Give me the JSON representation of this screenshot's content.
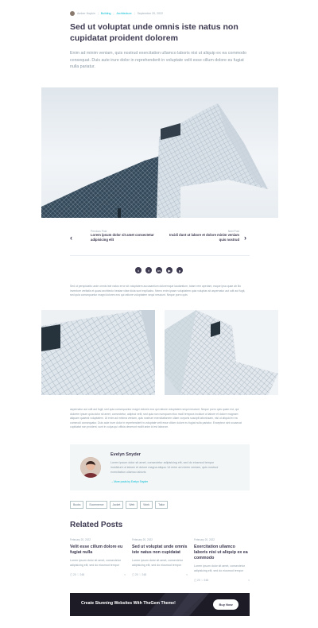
{
  "meta": {
    "author": "Amber Hopkin",
    "cat1": "Building",
    "cat2": "Architecture",
    "date": "September 20, 2022"
  },
  "post": {
    "title": "Sed ut voluptat unde omnis iste natus non cupidatat proident dolorem",
    "lead": "Enim ad minim veniam, quis nostrud exercitation ullamco laboris nisi ut aliquip ex ea commodo consequat. Duis aute irure dolor in reprehenderit in voluptate velit esse cillum dolore eu fugiat nulla pariatur."
  },
  "nav": {
    "prev_label": "Previous Post",
    "prev_title": "Lorem ipsum dolor sit amet consectetur adipisicing elit",
    "next_label": "Next Post",
    "next_title": "Incidi dunt ut labore et dolore minim veniam quis nostrud"
  },
  "social": [
    "twitter-icon",
    "facebook-icon",
    "linkedin-icon",
    "youtube-icon",
    "pinterest-icon"
  ],
  "body": {
    "p1": "Sed ut perspiciatis unde omnis iste natus error sit voluptatem accusantium doloremque laudantium, totam rem aperiam, eaque ipsa quae ab illo inventore veritatis et quasi architecto beatae vitae dicta sunt explicabo. Nemo enim ipsam voluptatem quia voluptas sit aspernatur aut odit aut fugit, sed quia consequuntur magni dolores eos qui ratione voluptatem sequi nesciunt. Neque porro quis",
    "p2": "aspernatur aut odit aut fugit, sed quia consequuntur magni dolores eos qui ratione voluptatem sequi nesciunt. Neque porro quis quam est, qui dolorem ipsum quia dolor sit amet, consectetur, adipisci velit, sed quia non numquam eius modi tempora incidunt ut labore et dolore magnam aliquam quaerat voluptatem. Ut enim ad minima veniam, quis nostrum exercitationem ullam corporis suscipit laboriosam, nisi ut aliquid ex ea commodi consequatur. Duis aute irure dolor in reprehenderit in voluptate velit esse cillum dolore eu fugiat nulla pariatur. Excepteur sint occaecat cupidatat non proident, sunt in culpa qui officia deserunt mollit anim id est laborum."
  },
  "author_box": {
    "name": "Evelyn Snyder",
    "desc": "Lorem ipsum dolor sit amet, consectetur adipisicing elit, sed do eiusmod tempor incididunt ut labore et dolore magna aliqua. Ut enim ad minim veniam, quis nostrud exercitation ullamco laboris",
    "link": "→ More posts by Evelyn Snyder"
  },
  "tags": [
    "Books",
    "Ecommerce",
    "Jacket",
    "Web",
    "Work",
    "Tailor"
  ],
  "related": {
    "heading": "Related Posts",
    "posts": [
      {
        "date": "February 20, 2022",
        "title": "Velit esse cillum dolore eu fugiat nulla",
        "excerpt": "Lorem ipsum dolor sit amet, consectetur adipisicing elit, sed do eiusmod tempor",
        "views": "20",
        "likes": "248"
      },
      {
        "date": "February 20, 2022",
        "title": "Sed ut voluptat unde omnis iste natus non cupidatat",
        "excerpt": "Lorem ipsum dolor sit amet, consectetur adipisicing elit, sed do eiusmod tempor",
        "views": "20",
        "likes": "248"
      },
      {
        "date": "February 20, 2022",
        "title": "Exercitation ullamco laboris nisi ut aliquip ex ea commodo",
        "excerpt": "Lorem ipsum dolor sit amet, consectetur adipisicing elit, sed do eiusmod tempor",
        "views": "20",
        "likes": "248"
      }
    ]
  },
  "banner": {
    "text": "Create Stunning Websites With TheGem Theme!",
    "button": "Buy Now"
  },
  "colors": {
    "accent": "#00bcd4",
    "heading": "#3c3950",
    "text": "#5f727f",
    "banner_bg": "#1c1b26"
  }
}
